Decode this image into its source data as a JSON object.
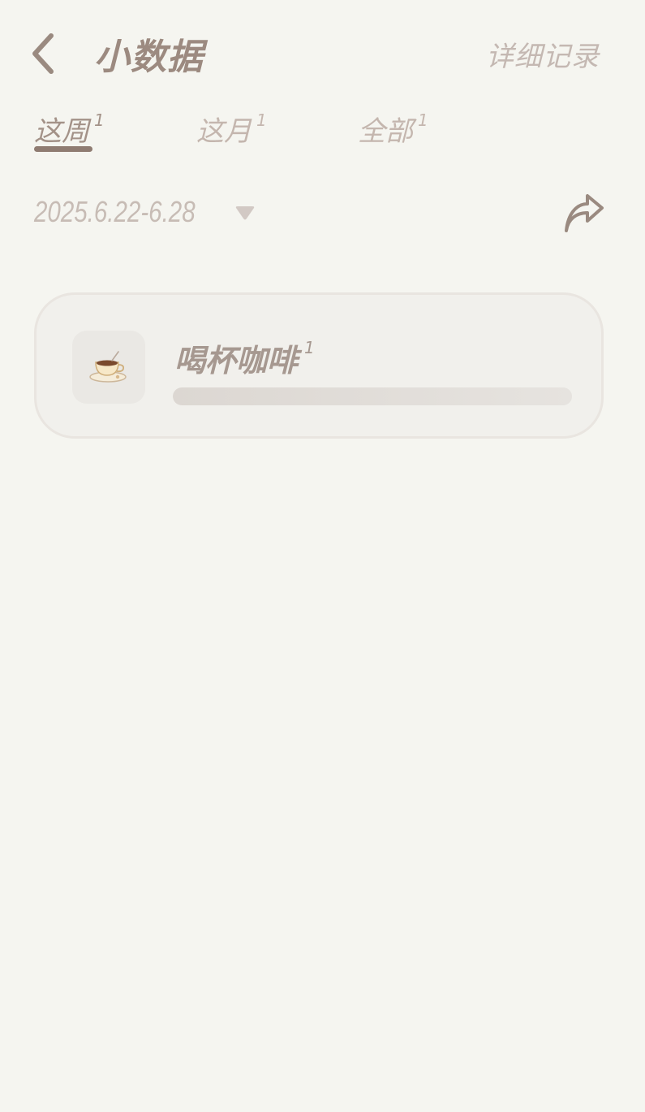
{
  "header": {
    "title": "小数据",
    "detail_link": "详细记录",
    "back_icon": "chevron-left-icon"
  },
  "tabs": [
    {
      "label": "这周",
      "count": "1",
      "active": true
    },
    {
      "label": "这月",
      "count": "1",
      "active": false
    },
    {
      "label": "全部",
      "count": "1",
      "active": false
    }
  ],
  "date_filter": {
    "range": "2025.6.22-6.28",
    "dropdown_icon": "caret-down-icon",
    "share_icon": "share-arrow-icon"
  },
  "items": [
    {
      "name": "喝杯咖啡",
      "count": "1",
      "icon": "coffee-cup-icon",
      "progress": 1.0
    }
  ],
  "colors": {
    "background": "#f5f5f0",
    "title": "#9c8a80",
    "muted": "#c4b8b2",
    "accent_underline": "#8f7c72",
    "card_bg": "#f1f0ec",
    "card_border": "#e9e5e0"
  }
}
